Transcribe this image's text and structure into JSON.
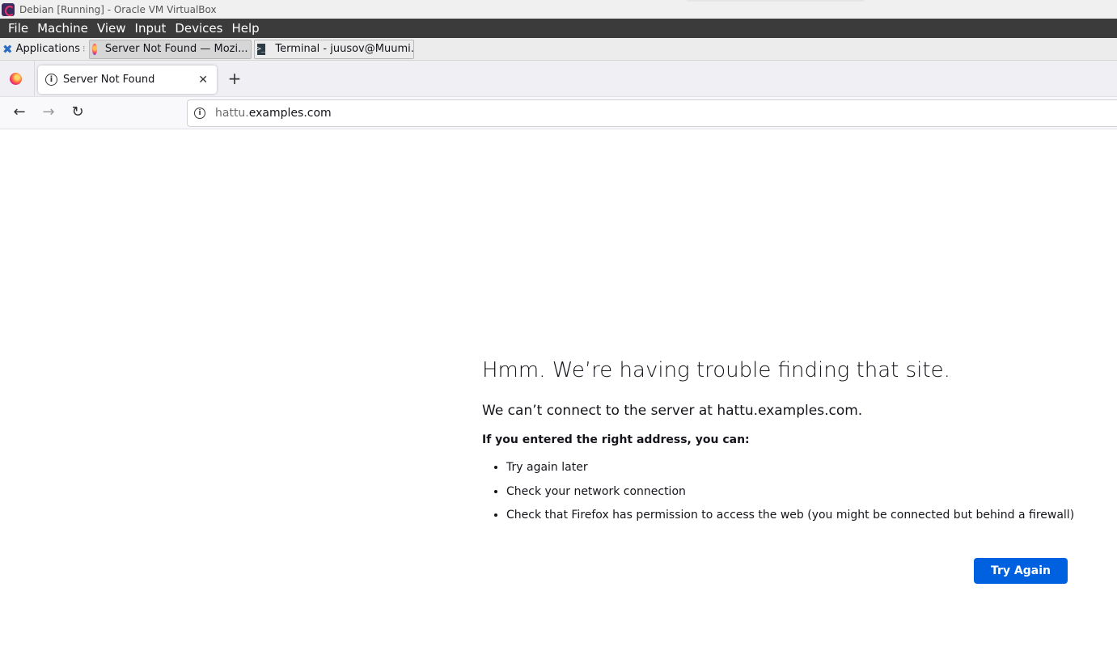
{
  "vbox": {
    "window_title": "Debian [Running] - Oracle VM VirtualBox",
    "menu": [
      "File",
      "Machine",
      "View",
      "Input",
      "Devices",
      "Help"
    ]
  },
  "panel": {
    "applications_label": "Applications",
    "tasks": [
      {
        "label": "Server Not Found — Mozi...",
        "icon": "firefox-icon",
        "active": true
      },
      {
        "label": "Terminal - juusov@Muumi...",
        "icon": "terminal-icon",
        "active": false
      }
    ]
  },
  "browser": {
    "tab_title": "Server Not Found",
    "new_tab_label": "+",
    "url_prefix": "hattu.",
    "url_domain": "examples.com"
  },
  "error_page": {
    "heading": "Hmm. We’re having trouble finding that site.",
    "message": "We can’t connect to the server at hattu.examples.com.",
    "hint": "If you entered the right address, you can:",
    "suggestions": [
      "Try again later",
      "Check your network connection",
      "Check that Firefox has permission to access the web (you might be connected but behind a firewall)"
    ],
    "button_label": "Try Again"
  },
  "colors": {
    "accent": "#0061e0",
    "vbox_menu_bg": "#3b3b3b"
  }
}
